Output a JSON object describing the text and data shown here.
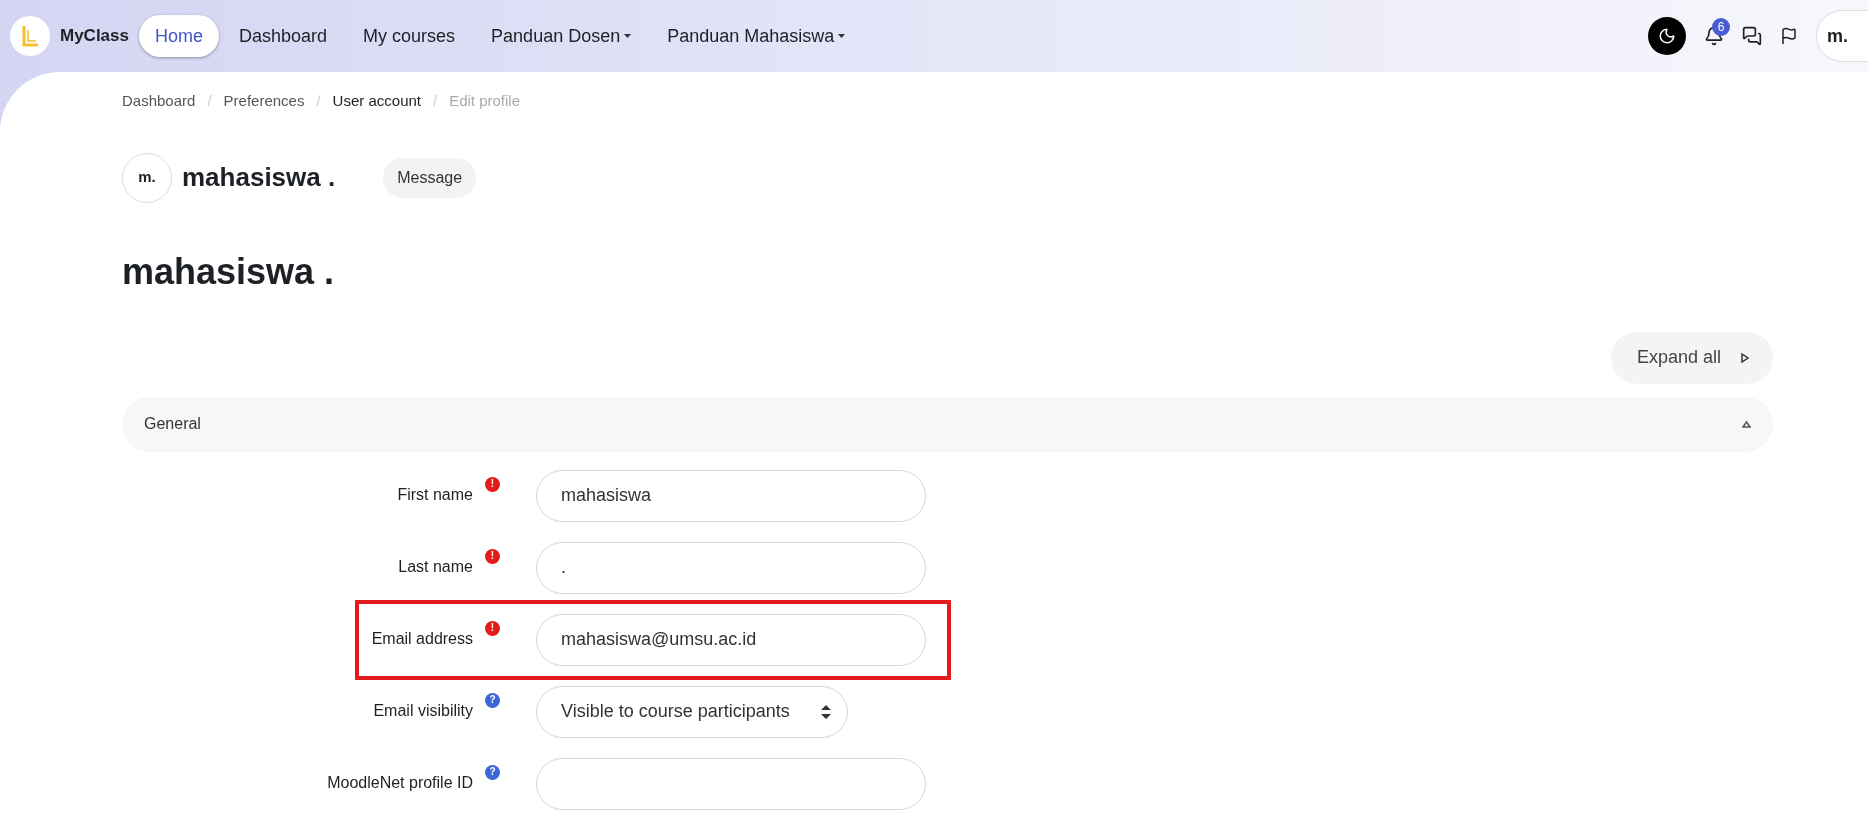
{
  "navbar": {
    "brand": "MyClass",
    "items": [
      {
        "label": "Home",
        "selected": true,
        "dropdown": false
      },
      {
        "label": "Dashboard",
        "selected": false,
        "dropdown": false
      },
      {
        "label": "My courses",
        "selected": false,
        "dropdown": false
      },
      {
        "label": "Panduan Dosen",
        "selected": false,
        "dropdown": true
      },
      {
        "label": "Panduan Mahasiswa",
        "selected": false,
        "dropdown": true
      }
    ],
    "notification_count": "6",
    "avatar_initials": "m."
  },
  "breadcrumb": [
    {
      "label": "Dashboard",
      "current": false
    },
    {
      "separator": "/"
    },
    {
      "label": "Preferences",
      "current": false
    },
    {
      "separator": "/"
    },
    {
      "label": "User account",
      "current": false
    },
    {
      "separator": "/"
    },
    {
      "label": "Edit profile",
      "current": true
    }
  ],
  "profile_header": {
    "initials": "m.",
    "name": "mahasiswa .",
    "message_button": "Message"
  },
  "page_title": "mahasiswa .",
  "expand_all": "Expand all",
  "section": {
    "title": "General",
    "expanded": true,
    "fields": [
      {
        "label": "First name",
        "indicator": {
          "kind": "required",
          "symbol": "!"
        },
        "kind": "text",
        "value": "mahasiswa",
        "highlighted": false
      },
      {
        "label": "Last name",
        "indicator": {
          "kind": "required",
          "symbol": "!"
        },
        "kind": "text",
        "value": ".",
        "highlighted": false
      },
      {
        "label": "Email address",
        "indicator": {
          "kind": "required",
          "symbol": "!"
        },
        "kind": "text",
        "value": "mahasiswa@umsu.ac.id",
        "highlighted": true
      },
      {
        "label": "Email visibility",
        "indicator": {
          "kind": "help",
          "symbol": "?"
        },
        "kind": "select",
        "value": "Visible to course participants",
        "highlighted": false
      },
      {
        "label": "MoodleNet profile ID",
        "indicator": {
          "kind": "help",
          "symbol": "?"
        },
        "kind": "text",
        "highlighted": false
      }
    ]
  }
}
